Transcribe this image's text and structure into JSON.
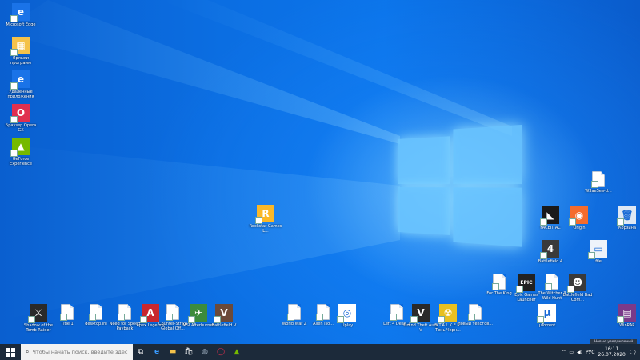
{
  "desktop_icons_left": [
    {
      "label": "Microsoft Edge",
      "icon": "edge-icon",
      "color": "#1a73e8",
      "glyph": "e"
    },
    {
      "label": "Ярлыки программ",
      "icon": "shortcuts-folder-icon",
      "color": "#f4c24a",
      "glyph": "▦"
    },
    {
      "label": "Удаленные приложения",
      "icon": "edge-icon",
      "color": "#1a73e8",
      "glyph": "e"
    },
    {
      "label": "Браузер Opera GX",
      "icon": "opera-gx-icon",
      "color": "#e0304f",
      "glyph": "O"
    },
    {
      "label": "GeForce Experience",
      "icon": "nvidia-icon",
      "color": "#76b900",
      "glyph": "▲"
    }
  ],
  "desktop_icon_center": {
    "label": "Rockstar Games L...",
    "icon": "rockstar-icon",
    "color": "#fbb829",
    "glyph": "R"
  },
  "desktop_icons_bottom": [
    {
      "label": "Shadow of the Tomb Raider",
      "icon": "tomb-raider-icon",
      "type": "game",
      "color": "#2a2a2a",
      "glyph": "⚔"
    },
    {
      "label": "Title 1",
      "icon": "document-icon",
      "type": "doc"
    },
    {
      "label": "desktop.ini",
      "icon": "document-icon",
      "type": "doc"
    },
    {
      "label": "Need for Speed Payback",
      "icon": "document-icon",
      "type": "doc"
    },
    {
      "label": "Apex Legends",
      "icon": "apex-icon",
      "type": "game",
      "color": "#c8272e",
      "glyph": "A"
    },
    {
      "label": "Counter-Strike Global Off...",
      "icon": "document-icon",
      "type": "doc"
    },
    {
      "label": "MSI Afterburner",
      "icon": "msi-afterburner-icon",
      "type": "game",
      "color": "#3c8b3c",
      "glyph": "✈"
    },
    {
      "label": "Battlefield V",
      "icon": "battlefield-v-icon",
      "type": "game",
      "color": "#6b4a3a",
      "glyph": "V"
    },
    {
      "label": "World War Z",
      "icon": "document-icon",
      "type": "doc"
    },
    {
      "label": "Alien Iso...",
      "icon": "document-icon",
      "type": "doc"
    },
    {
      "label": "Uplay",
      "icon": "uplay-icon",
      "type": "game",
      "color": "#ffffff",
      "glyph": "◎"
    },
    {
      "label": "Left 4 Dead 2",
      "icon": "document-icon",
      "type": "doc"
    },
    {
      "label": "Grand Theft Auto V",
      "icon": "gta-v-icon",
      "type": "game",
      "color": "#2a2a2a",
      "glyph": "V"
    },
    {
      "label": "S.T.A.L.K.E.R. Тень Черн...",
      "icon": "stalker-icon",
      "type": "game",
      "color": "#e8c020",
      "glyph": "☢"
    },
    {
      "label": "Новый текстов...",
      "icon": "document-icon",
      "type": "doc"
    },
    {
      "label": "μTorrent",
      "icon": "utorrent-icon",
      "type": "game",
      "color": "#ffffff",
      "glyph": "µ"
    },
    {
      "label": "WinRAR",
      "icon": "winrar-icon",
      "type": "game",
      "color": "#7a3a8a",
      "glyph": "▤"
    }
  ],
  "desktop_icons_right": [
    {
      "label": "W3aeSea-d...",
      "icon": "document-icon",
      "type": "doc"
    },
    {
      "label": "FACEIT AC",
      "icon": "faceit-icon",
      "type": "game",
      "color": "#1a1a1a",
      "glyph": "◣"
    },
    {
      "label": "Origin",
      "icon": "origin-icon",
      "type": "game",
      "color": "#f56c2d",
      "glyph": "◉"
    },
    {
      "label": "Корзина",
      "icon": "recycle-bin-icon",
      "type": "game",
      "color": "#dfe8f4",
      "glyph": "🗑"
    },
    {
      "label": "Battlefield 4",
      "icon": "battlefield-4-icon",
      "type": "game",
      "color": "#3a3a3a",
      "glyph": "4"
    },
    {
      "label": "file",
      "icon": "file-icon",
      "type": "game",
      "color": "#eef3fa",
      "glyph": "▭"
    },
    {
      "label": "For The King",
      "icon": "document-icon",
      "type": "doc"
    },
    {
      "label": "Epic Games Launcher",
      "icon": "epic-games-icon",
      "type": "game",
      "color": "#222222",
      "glyph": "EPIC"
    },
    {
      "label": "The Witcher 3 Wild Hunt",
      "icon": "document-icon",
      "type": "doc"
    },
    {
      "label": "Battlefield Bad Com...",
      "icon": "battlefield-bad-company-icon",
      "type": "game",
      "color": "#3a3a3a",
      "glyph": "☻"
    }
  ],
  "taskbar": {
    "search_placeholder": "Чтобы начать поиск, введите здесь запрос",
    "pinned": [
      "task-view-icon",
      "edge-icon",
      "file-explorer-icon",
      "store-icon",
      "steam-icon",
      "opera-gx-icon",
      "nvidia-icon"
    ],
    "tray": {
      "up_arrow": "^",
      "network": "▭",
      "volume": "◀)",
      "language": "РУС"
    },
    "time": "16:11",
    "date": "26.07.2020",
    "notification_tooltip": "Новые уведомлений нет"
  }
}
